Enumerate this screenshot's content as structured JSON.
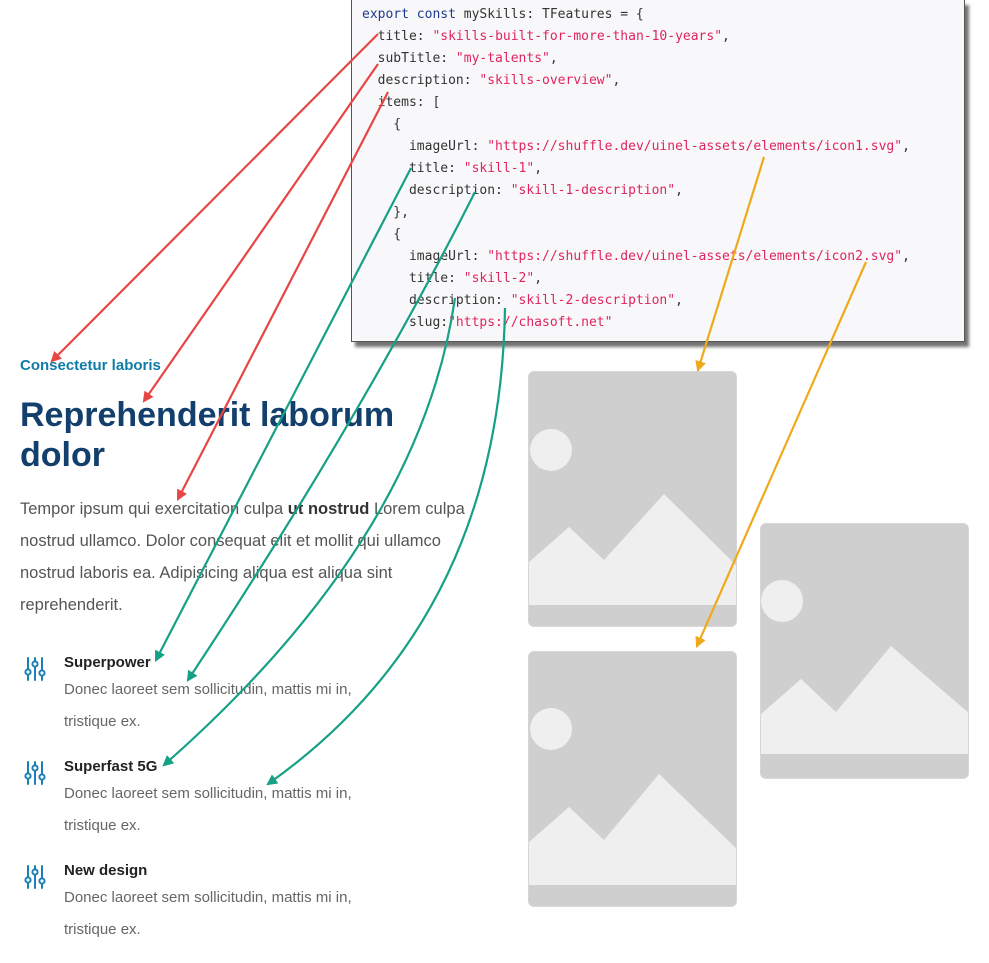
{
  "code": {
    "lines": [
      [
        {
          "c": "kw",
          "t": "export const "
        },
        {
          "c": "pl",
          "t": "mySkills: TFeatures = {"
        }
      ],
      [
        {
          "c": "pl",
          "t": "  title: "
        },
        {
          "c": "str",
          "t": "\"skills-built-for-more-than-10-years\""
        },
        {
          "c": "pl",
          "t": ","
        }
      ],
      [
        {
          "c": "pl",
          "t": "  subTitle: "
        },
        {
          "c": "str",
          "t": "\"my-talents\""
        },
        {
          "c": "pl",
          "t": ","
        }
      ],
      [
        {
          "c": "pl",
          "t": "  description: "
        },
        {
          "c": "str",
          "t": "\"skills-overview\""
        },
        {
          "c": "pl",
          "t": ","
        }
      ],
      [
        {
          "c": "pl",
          "t": "  items: ["
        }
      ],
      [
        {
          "c": "pl",
          "t": "    {"
        }
      ],
      [
        {
          "c": "pl",
          "t": "      imageUrl: "
        },
        {
          "c": "str",
          "t": "\"https://shuffle.dev/uinel-assets/elements/icon1.svg\""
        },
        {
          "c": "pl",
          "t": ","
        }
      ],
      [
        {
          "c": "pl",
          "t": "      title: "
        },
        {
          "c": "str",
          "t": "\"skill-1\""
        },
        {
          "c": "pl",
          "t": ","
        }
      ],
      [
        {
          "c": "pl",
          "t": "      description: "
        },
        {
          "c": "str",
          "t": "\"skill-1-description\""
        },
        {
          "c": "pl",
          "t": ","
        }
      ],
      [
        {
          "c": "pl",
          "t": "    },"
        }
      ],
      [
        {
          "c": "pl",
          "t": "    {"
        }
      ],
      [
        {
          "c": "pl",
          "t": "      imageUrl: "
        },
        {
          "c": "str",
          "t": "\"https://shuffle.dev/uinel-assets/elements/icon2.svg\""
        },
        {
          "c": "pl",
          "t": ","
        }
      ],
      [
        {
          "c": "pl",
          "t": "      title: "
        },
        {
          "c": "str",
          "t": "\"skill-2\""
        },
        {
          "c": "pl",
          "t": ","
        }
      ],
      [
        {
          "c": "pl",
          "t": "      description: "
        },
        {
          "c": "str",
          "t": "\"skill-2-description\""
        },
        {
          "c": "pl",
          "t": ","
        }
      ],
      [
        {
          "c": "pl",
          "t": "      slug:"
        },
        {
          "c": "str",
          "t": "\"https://chasoft.net\""
        }
      ]
    ]
  },
  "section": {
    "subtitle": "Consectetur laboris",
    "title": "Reprehenderit laborum dolor",
    "description_before": "Tempor ipsum qui exercitation culpa ",
    "description_bold": "ut nostrud",
    "description_after": " Lorem culpa nostrud ullamco. Dolor consequat elit et mollit qui ullamco nostrud laboris ea. Adipisicing aliqua est aliqua sint reprehenderit."
  },
  "features": [
    {
      "title": "Superpower",
      "description": "Donec laoreet sem sollicitudin, mattis mi in, tristique ex.",
      "icon": "sliders-icon"
    },
    {
      "title": "Superfast 5G",
      "description": "Donec laoreet sem sollicitudin, mattis mi in, tristique ex.",
      "icon": "sliders-icon"
    },
    {
      "title": "New design",
      "description": "Donec laoreet sem sollicitudin, mattis mi in, tristique ex.",
      "icon": "sliders-icon"
    }
  ],
  "colors": {
    "subtitle": "#0f7ca8",
    "title": "#123f6b",
    "icon": "#1a7fb3",
    "arrow_red": "#e84545",
    "arrow_green": "#16a085",
    "arrow_orange": "#eeaa1a"
  }
}
